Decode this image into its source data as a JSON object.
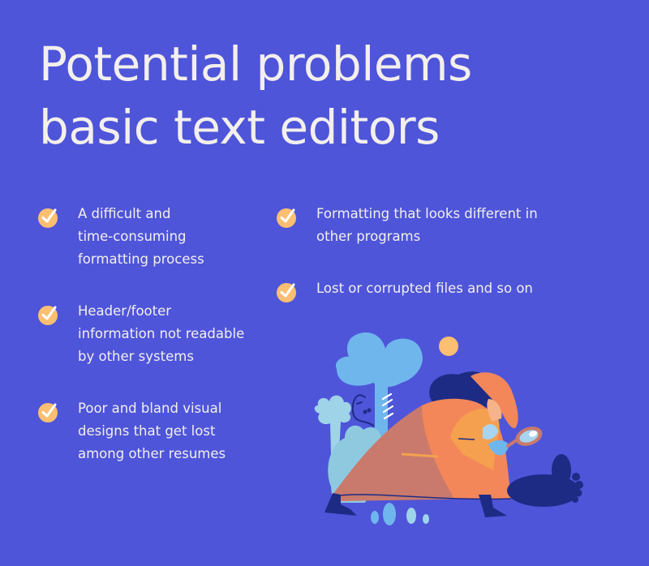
{
  "title": {
    "line1": "Potential problems",
    "line2": "basic text editors"
  },
  "colors": {
    "background": "#4e55d9",
    "text": "#f3efec",
    "check_circle": "#fbbf72",
    "check_mark": "#ffffff"
  },
  "left_column": [
    {
      "icon": "check-circle-icon",
      "lines": [
        "A difficult and",
        "time-consuming",
        "formatting process"
      ]
    },
    {
      "icon": "check-circle-icon",
      "lines": [
        "Header/footer",
        "information not readable",
        "by other systems"
      ]
    },
    {
      "icon": "check-circle-icon",
      "lines": [
        "Poor and bland visual",
        "designs that get lost",
        "among other resumes"
      ]
    }
  ],
  "right_column": [
    {
      "icon": "check-circle-icon",
      "lines": [
        "Formatting that looks different in",
        "other programs"
      ]
    },
    {
      "icon": "check-circle-icon",
      "lines": [
        "Lost or corrupted files and so on"
      ]
    }
  ],
  "illustration": {
    "subject": "detective-with-magnifying-glass-illustration"
  }
}
